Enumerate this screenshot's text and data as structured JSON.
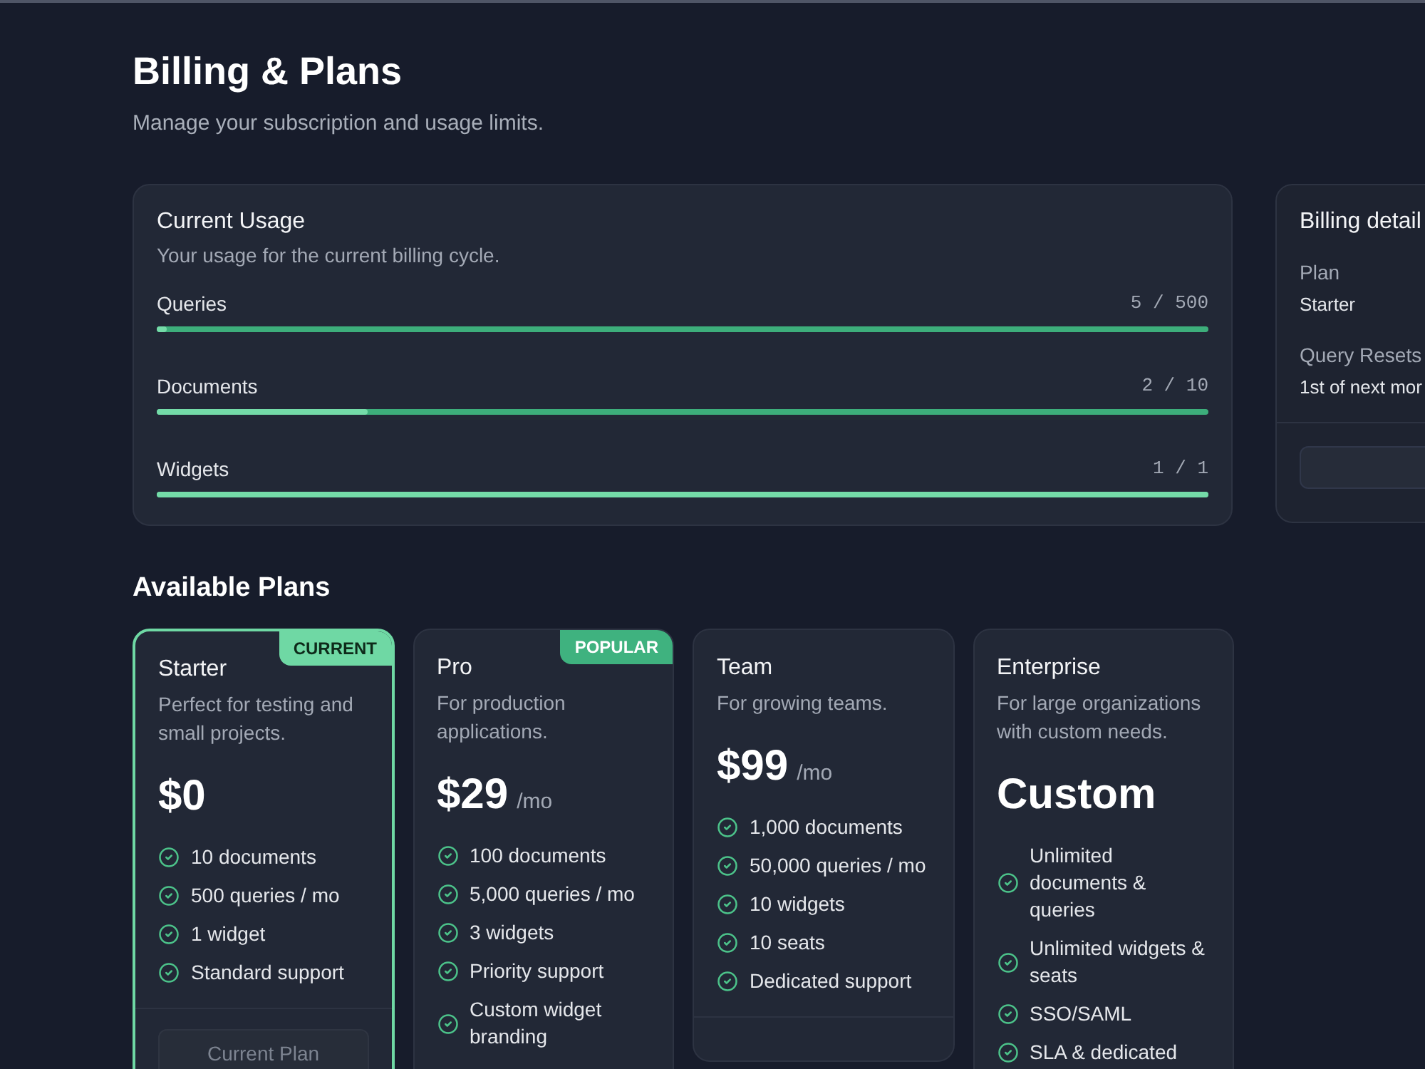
{
  "page": {
    "title": "Billing & Plans",
    "subtitle": "Manage your subscription and usage limits."
  },
  "usage": {
    "title": "Current Usage",
    "subtitle": "Your usage for the current billing cycle.",
    "meters": [
      {
        "label": "Queries",
        "reading": "5 / 500",
        "level": 0.01
      },
      {
        "label": "Documents",
        "reading": "2 / 10",
        "level": 0.2
      },
      {
        "label": "Widgets",
        "reading": "1 / 1",
        "level": 1
      }
    ]
  },
  "billing_details": {
    "title": "Billing detail",
    "fields": [
      {
        "label": "Plan",
        "value": "Starter"
      },
      {
        "label": "Query Resets",
        "value": "1st of next mor"
      }
    ],
    "action_button": true
  },
  "plans": {
    "title": "Available Plans",
    "items": [
      {
        "name": "Starter",
        "description": "Perfect for testing and small projects.",
        "price": "$0",
        "current": true,
        "badge": {
          "kind": "current",
          "text": "CURRENT"
        },
        "features": [
          "10 documents",
          "500 queries / mo",
          "1 widget",
          "Standard support"
        ],
        "button": {
          "label": "Current Plan",
          "disabled": true
        }
      },
      {
        "name": "Pro",
        "description": "For production applications.",
        "price": "$29",
        "period": "/mo",
        "current": false,
        "badge": {
          "kind": "popular",
          "text": "POPULAR"
        },
        "features": [
          "100 documents",
          "5,000 queries / mo",
          "3 widgets",
          "Priority support",
          "Custom widget branding"
        ]
      },
      {
        "name": "Team",
        "description": "For growing teams.",
        "price": "$99",
        "period": "/mo",
        "current": false,
        "features": [
          "1,000 documents",
          "50,000 queries / mo",
          "10 widgets",
          "10 seats",
          "Dedicated support"
        ]
      },
      {
        "name": "Enterprise",
        "description": "For large organizations with custom needs.",
        "price": "Custom",
        "current": false,
        "features": [
          "Unlimited documents & queries",
          "Unlimited widgets & seats",
          "SSO/SAML",
          "SLA & dedicated"
        ]
      }
    ]
  }
}
